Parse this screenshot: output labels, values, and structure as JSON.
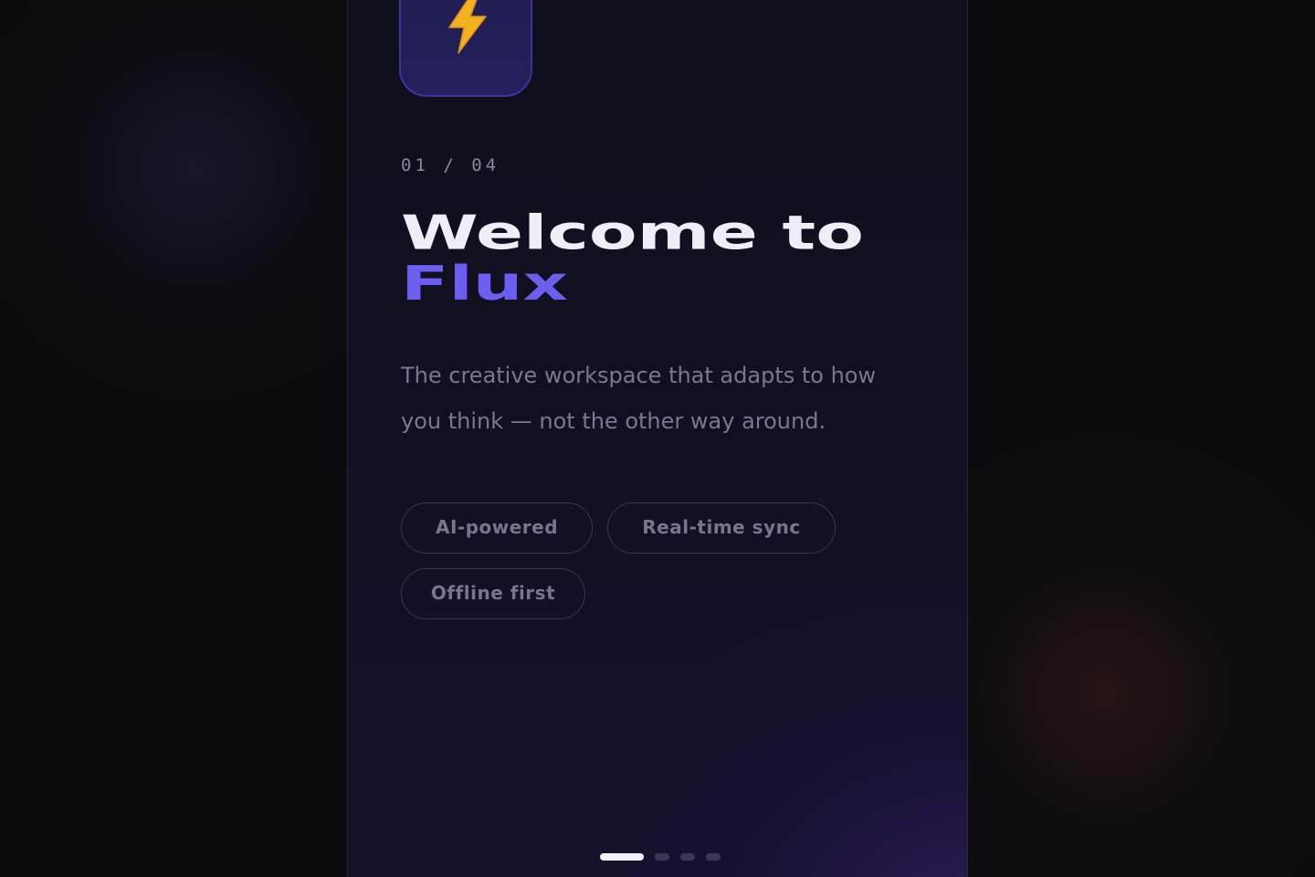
{
  "onboarding": {
    "step_counter": "01 / 04",
    "headline_line1": "Welcome to",
    "headline_accent": "Flux",
    "tagline": "The creative workspace that adapts to how you think — not the other way around.",
    "feature_chips": [
      {
        "label": "AI-powered"
      },
      {
        "label": "Real-time sync"
      },
      {
        "label": "Offline first"
      }
    ],
    "app_icon": {
      "icon": "lightning-bolt-icon"
    },
    "pagination": {
      "total": 4,
      "current": 1
    }
  },
  "colors": {
    "accent": "#6b5ff0",
    "headline": "#efedf6",
    "body_text": "#7a7693",
    "bolt": "#f5b21f"
  }
}
